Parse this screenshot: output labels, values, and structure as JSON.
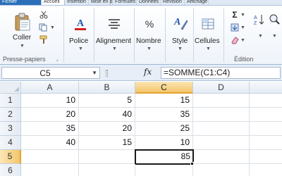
{
  "tabs": {
    "file": "Fichier",
    "items": [
      "Accueil",
      "Insertion",
      "Mise en page",
      "Formules",
      "Données",
      "Révision",
      "Affichage"
    ]
  },
  "ribbon": {
    "clipboard": {
      "paste_label": "Coller",
      "group_label": "Presse-papiers"
    },
    "font_label": "Police",
    "alignment_label": "Alignement",
    "number_label": "Nombre",
    "style_label": "Style",
    "cells_label": "Cellules",
    "editing_group_label": "Édition",
    "icons": [
      "clipboard-icon",
      "scissors-icon",
      "copy-icon",
      "format-painter-icon",
      "font-color-icon",
      "align-icon",
      "percent-icon",
      "style-icon",
      "cells-icon",
      "sum-icon",
      "fill-icon",
      "clear-icon",
      "sort-icon",
      "find-icon"
    ]
  },
  "formula_bar": {
    "name_box": "C5",
    "fx_label": "fx",
    "formula": "=SOMME(C1:C4)"
  },
  "sheet": {
    "columns": [
      "A",
      "B",
      "C",
      "D"
    ],
    "rows": [
      {
        "num": "1",
        "cells": [
          "10",
          "5",
          "15",
          ""
        ]
      },
      {
        "num": "2",
        "cells": [
          "20",
          "40",
          "35",
          ""
        ]
      },
      {
        "num": "3",
        "cells": [
          "35",
          "20",
          "25",
          ""
        ]
      },
      {
        "num": "4",
        "cells": [
          "40",
          "15",
          "10",
          ""
        ]
      },
      {
        "num": "5",
        "cells": [
          "",
          "",
          "85",
          ""
        ]
      },
      {
        "num": "6",
        "cells": [
          "",
          "",
          "",
          ""
        ]
      }
    ],
    "active_cell": "C5"
  },
  "colors": {
    "selection_header": "#f3c66c",
    "file_tab": "#2a6fb8"
  }
}
